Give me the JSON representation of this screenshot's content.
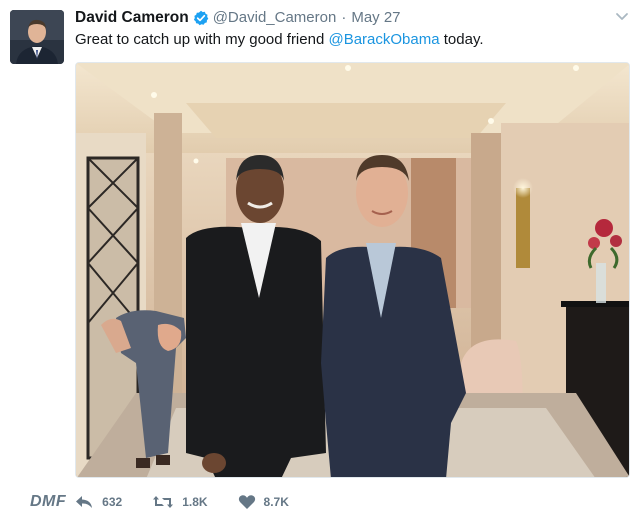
{
  "tweet": {
    "author_name": "David Cameron",
    "handle": "@David_Cameron",
    "separator": "·",
    "date": "May 27",
    "text_before": "Great to catch up with my good friend ",
    "mention": "@BarackObama",
    "text_after": " today."
  },
  "actions": {
    "watermark": "DMF",
    "replies": "632",
    "retweets": "1.8K",
    "likes": "8.7K"
  },
  "icons": {
    "verified": "verified-badge-icon",
    "more": "chevron-down-icon",
    "reply": "reply-icon",
    "retweet": "retweet-icon",
    "like": "heart-icon"
  },
  "colors": {
    "link": "#1b95e0",
    "verified": "#1da1f2",
    "secondary_text": "#657786"
  }
}
